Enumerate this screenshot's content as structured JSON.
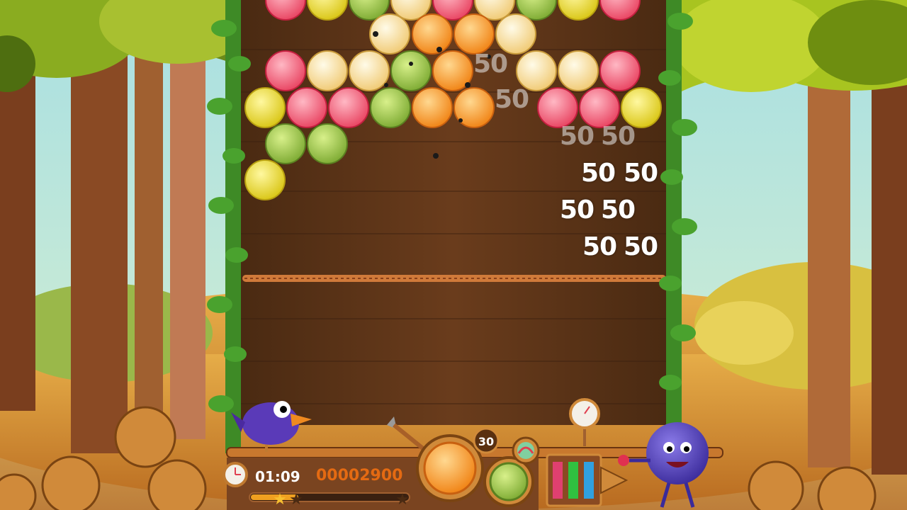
{
  "hud": {
    "timer": "01:09",
    "score": "00002900",
    "shots_left": "30",
    "star_progress": 0.3
  },
  "score_popups": [
    "50",
    "50",
    "50",
    "50",
    "50",
    "50",
    "50",
    "50",
    "50",
    "50"
  ],
  "bubble_types": [
    "strawberry",
    "apple",
    "banana",
    "orange",
    "kiwi"
  ],
  "colors": {
    "wood": "#5a3418",
    "hud_orange": "#e46a12",
    "strawberry": "#ee4a66",
    "apple": "#e8dc1e",
    "banana": "#f6d47e",
    "orange": "#f39014",
    "kiwi": "#8ab83a"
  },
  "icons": {
    "timer": "clock-icon",
    "launcher": "arrow-launcher-icon",
    "power_bars": "power-bars-icon",
    "gauge": "pressure-gauge-icon",
    "bird": "purple-bird",
    "monster": "blueberry-monster"
  }
}
